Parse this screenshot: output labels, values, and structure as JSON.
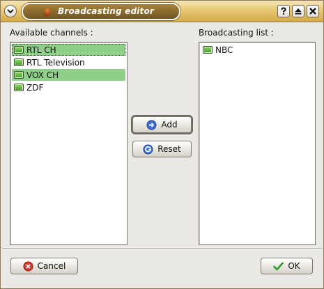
{
  "window": {
    "title": "Broadcasting editor"
  },
  "left_panel": {
    "label": "Available channels :",
    "items": [
      {
        "label": "RTL CH",
        "selected": true,
        "focused": true
      },
      {
        "label": "RTL Television",
        "selected": false,
        "focused": false
      },
      {
        "label": "VOX CH",
        "selected": true,
        "focused": false
      },
      {
        "label": "ZDF",
        "selected": false,
        "focused": false
      }
    ]
  },
  "right_panel": {
    "label": "Broadcasting list :",
    "items": [
      {
        "label": "NBC"
      }
    ]
  },
  "buttons": {
    "add": "Add",
    "reset": "Reset",
    "cancel": "Cancel",
    "ok": "OK"
  },
  "colors": {
    "selection": "#8fcf8a",
    "title_bar": "#e8c873",
    "title_pill": "#8a6a2c"
  },
  "icons": {
    "channel": "tv-icon",
    "add": "arrow-right-icon",
    "reset": "reset-icon",
    "cancel": "cancel-icon",
    "ok": "check-icon"
  }
}
